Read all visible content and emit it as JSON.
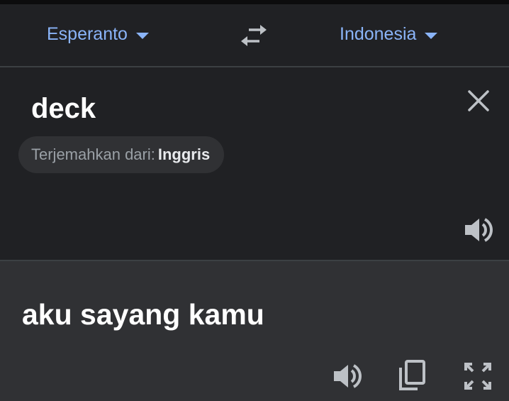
{
  "language_bar": {
    "source_language": "Esperanto",
    "target_language": "Indonesia",
    "swap_icon": "swap-arrows-icon",
    "caret_icon": "caret-down-icon"
  },
  "source": {
    "text": "deck",
    "clear_icon": "close-icon",
    "detect_label": "Terjemahkan dari:",
    "detect_language": "Inggris",
    "speak_icon": "speaker-icon"
  },
  "result": {
    "text": "aku sayang kamu",
    "speak_icon": "speaker-icon",
    "copy_icon": "copy-icon",
    "fullscreen_icon": "fullscreen-icon"
  },
  "colors": {
    "background": "#202124",
    "result_background": "#303134",
    "accent": "#8ab4f8",
    "text": "#ffffff",
    "muted": "#9aa0a6"
  }
}
